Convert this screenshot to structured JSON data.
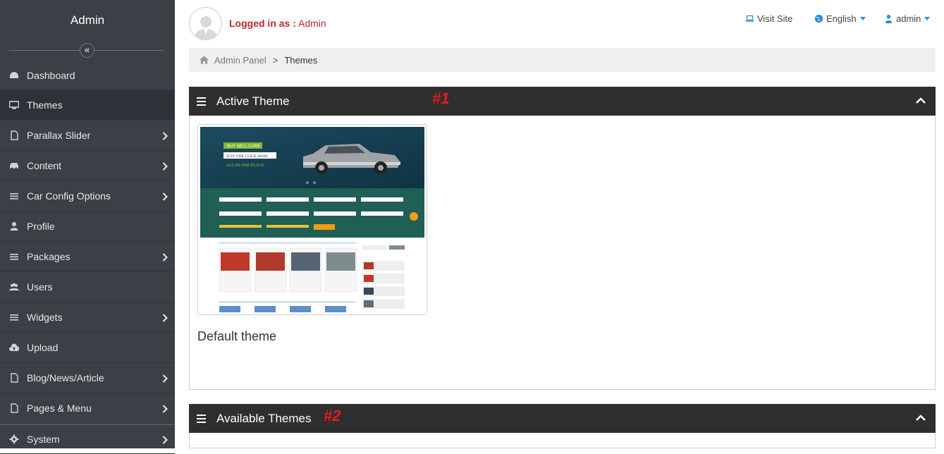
{
  "sidebar": {
    "brand": "Admin",
    "items": [
      {
        "label": "Dashboard",
        "icon": "dashboard-icon",
        "arrow": false
      },
      {
        "label": "Themes",
        "icon": "monitor-icon",
        "arrow": false
      },
      {
        "label": "Parallax Slider",
        "icon": "file-icon",
        "arrow": true
      },
      {
        "label": "Content",
        "icon": "car-icon",
        "arrow": true
      },
      {
        "label": "Car Config Options",
        "icon": "list-icon",
        "arrow": true
      },
      {
        "label": "Profile",
        "icon": "user-icon",
        "arrow": false
      },
      {
        "label": "Packages",
        "icon": "list-icon",
        "arrow": true
      },
      {
        "label": "Users",
        "icon": "users-icon",
        "arrow": false
      },
      {
        "label": "Widgets",
        "icon": "list-icon",
        "arrow": true
      },
      {
        "label": "Upload",
        "icon": "cloud-upload-icon",
        "arrow": false
      },
      {
        "label": "Blog/News/Article",
        "icon": "file-icon",
        "arrow": true
      },
      {
        "label": "Pages & Menu",
        "icon": "file-icon",
        "arrow": true
      },
      {
        "label": "System",
        "icon": "gear-icon",
        "arrow": true
      }
    ]
  },
  "header": {
    "logged_prefix": "Logged in as :",
    "logged_user": "Admin",
    "visit_site": "Visit Site",
    "language": "English",
    "user_menu": "admin"
  },
  "breadcrumb": {
    "root": "Admin Panel",
    "separator": ">",
    "current": "Themes"
  },
  "active_panel": {
    "title": "Active Theme",
    "tag": "#1",
    "theme_name": "Default theme",
    "thumbnail": {
      "badge1": "BUY SELL CARS",
      "badge2": "JUST ONE CLICK AWAY",
      "badge3": "ALL IN ONE PLACE"
    }
  },
  "available_panel": {
    "title": "Available Themes",
    "tag": "#2"
  },
  "colors": {
    "sidebar_bg": "#3b3f46",
    "panel_head_bg": "#2f2f30",
    "accent_red": "#c0262c",
    "tag_red": "#e51b1b",
    "link_blue": "#2a8fd6"
  }
}
